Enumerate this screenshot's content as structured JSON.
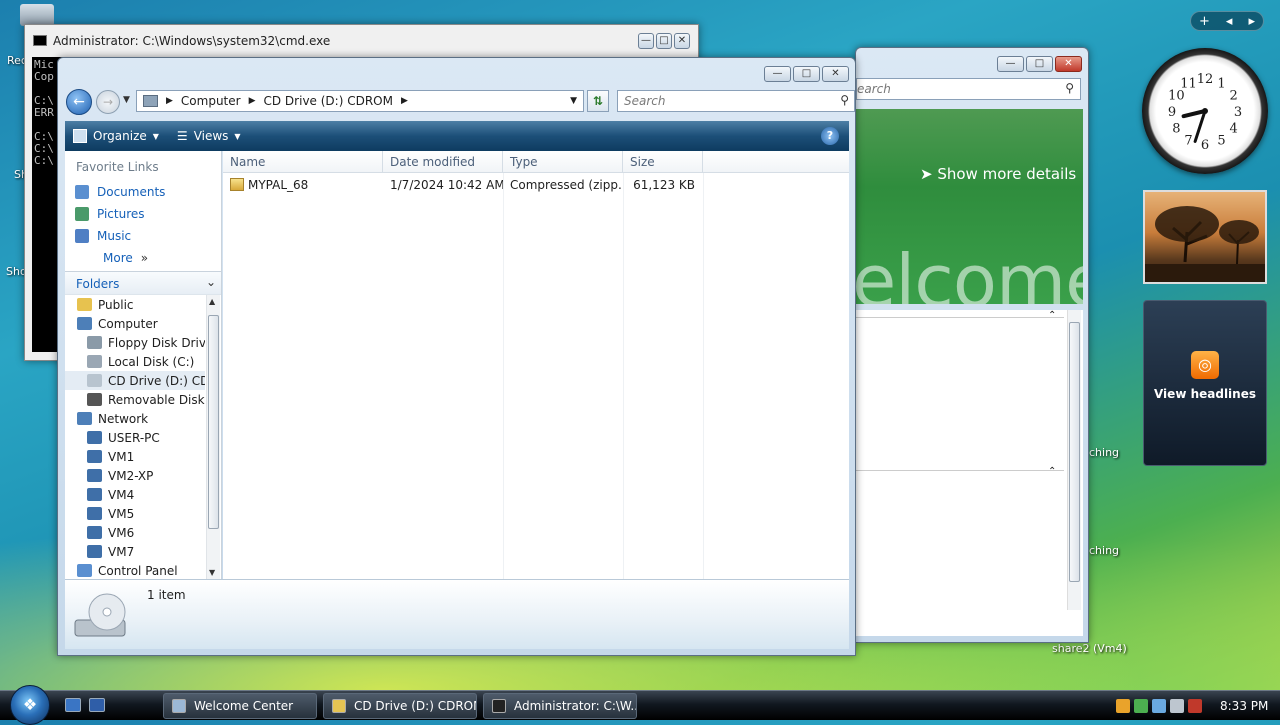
{
  "desktop": {
    "left_labels": [
      "Rec",
      "Sh",
      "Sho"
    ],
    "right_labels": [
      "ching",
      "ching",
      "share2 (Vm4)"
    ]
  },
  "gadgets": {
    "sidebar_controls": [
      "+",
      "◂",
      "▸"
    ],
    "clock": {
      "hour": 8,
      "minute": 33,
      "numerals": [
        "12",
        "1",
        "2",
        "3",
        "4",
        "5",
        "6",
        "7",
        "8",
        "9",
        "10",
        "11"
      ]
    },
    "feed": {
      "label": "View headlines",
      "icon": "rss-icon"
    }
  },
  "cmd": {
    "title": "Administrator: C:\\Windows\\system32\\cmd.exe",
    "lines": [
      "Mic",
      "Cop",
      "",
      "C:\\",
      "ERR",
      "",
      "C:\\",
      "C:\\",
      "C:\\"
    ]
  },
  "welcome": {
    "search_placeholder": "earch",
    "show_more": "Show more details",
    "watermark": "elcome"
  },
  "explorer": {
    "breadcrumb": [
      "Computer",
      "CD Drive (D:) CDROM"
    ],
    "search_placeholder": "Search",
    "toolbar": {
      "organize": "Organize",
      "views": "Views",
      "help": "?"
    },
    "favorites_header": "Favorite Links",
    "favorites": [
      {
        "label": "Documents",
        "color": "#5a8fd0"
      },
      {
        "label": "Pictures",
        "color": "#4a9a6a"
      },
      {
        "label": "Music",
        "color": "#4f7fc4"
      },
      {
        "label": "More",
        "color": ""
      }
    ],
    "folders_header": "Folders",
    "tree": [
      {
        "label": "Public",
        "indent": 0,
        "icon": "folder-icon",
        "color": "#e7c24f"
      },
      {
        "label": "Computer",
        "indent": 0,
        "icon": "computer-icon",
        "color": "#4d7fb8"
      },
      {
        "label": "Floppy Disk Drive (",
        "indent": 1,
        "icon": "floppy-icon",
        "color": "#8a9aa8"
      },
      {
        "label": "Local Disk (C:)",
        "indent": 1,
        "icon": "disk-icon",
        "color": "#9aa7b4"
      },
      {
        "label": "CD Drive (D:) CDRO",
        "indent": 1,
        "icon": "cd-icon",
        "color": "#b8c4cf",
        "selected": true
      },
      {
        "label": "Removable Disk (E",
        "indent": 1,
        "icon": "usb-icon",
        "color": "#555"
      },
      {
        "label": "Network",
        "indent": 0,
        "icon": "network-icon",
        "color": "#4d7fb8"
      },
      {
        "label": "USER-PC",
        "indent": 1,
        "icon": "pc-icon",
        "color": "#3f6fa8"
      },
      {
        "label": "VM1",
        "indent": 1,
        "icon": "pc-icon",
        "color": "#3f6fa8"
      },
      {
        "label": "VM2-XP",
        "indent": 1,
        "icon": "pc-icon",
        "color": "#3f6fa8"
      },
      {
        "label": "VM4",
        "indent": 1,
        "icon": "pc-icon",
        "color": "#3f6fa8"
      },
      {
        "label": "VM5",
        "indent": 1,
        "icon": "pc-icon",
        "color": "#3f6fa8"
      },
      {
        "label": "VM6",
        "indent": 1,
        "icon": "pc-icon",
        "color": "#3f6fa8"
      },
      {
        "label": "VM7",
        "indent": 1,
        "icon": "pc-icon",
        "color": "#3f6fa8"
      },
      {
        "label": "Control Panel",
        "indent": 0,
        "icon": "control-panel-icon",
        "color": "#5a8fd0"
      }
    ],
    "columns": [
      "Name",
      "Date modified",
      "Type",
      "Size"
    ],
    "files": [
      {
        "name": "MYPAL_68",
        "date": "1/7/2024 10:42 AM",
        "type": "Compressed (zipp...",
        "size": "61,123 KB"
      }
    ],
    "status": "1 item"
  },
  "taskbar": {
    "start": "start-orb",
    "tasks": [
      {
        "label": "Welcome Center",
        "color": "#9bb8d6"
      },
      {
        "label": "CD Drive (D:) CDROM",
        "color": "#e5c453"
      },
      {
        "label": "Administrator: C:\\W...",
        "color": "#222"
      }
    ],
    "tray_colors": [
      "#e9a32b",
      "#4caf50",
      "#6aa9e0",
      "#bdc6cf",
      "#c0392b"
    ],
    "time": "8:33 PM"
  }
}
